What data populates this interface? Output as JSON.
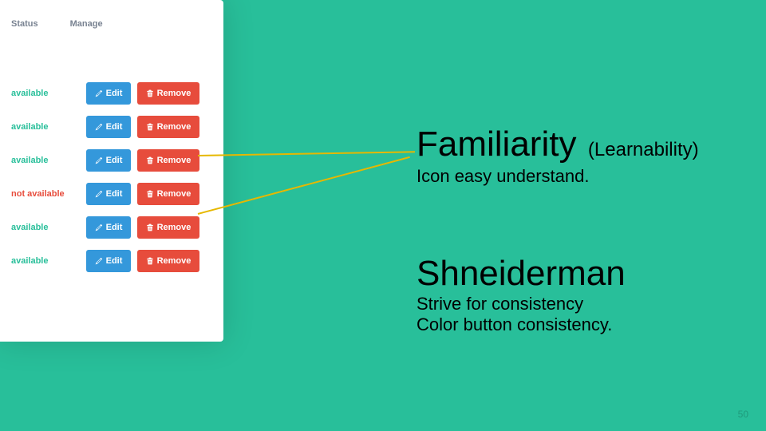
{
  "panel": {
    "headers": [
      "Status",
      "Manage"
    ],
    "rows": [
      {
        "status": "available",
        "ok": true,
        "edit": "Edit",
        "remove": "Remove"
      },
      {
        "status": "available",
        "ok": true,
        "edit": "Edit",
        "remove": "Remove"
      },
      {
        "status": "available",
        "ok": true,
        "edit": "Edit",
        "remove": "Remove"
      },
      {
        "status": "not available",
        "ok": false,
        "edit": "Edit",
        "remove": "Remove"
      },
      {
        "status": "available",
        "ok": true,
        "edit": "Edit",
        "remove": "Remove"
      },
      {
        "status": "available",
        "ok": true,
        "edit": "Edit",
        "remove": "Remove"
      }
    ]
  },
  "text": {
    "heading1": "Familiarity",
    "paren1": "(Learnability)",
    "sub1": "Icon easy understand.",
    "heading2": "Shneiderman",
    "sub2a": "Strive for consistency",
    "sub2b": "Color button consistency."
  },
  "page": "50"
}
